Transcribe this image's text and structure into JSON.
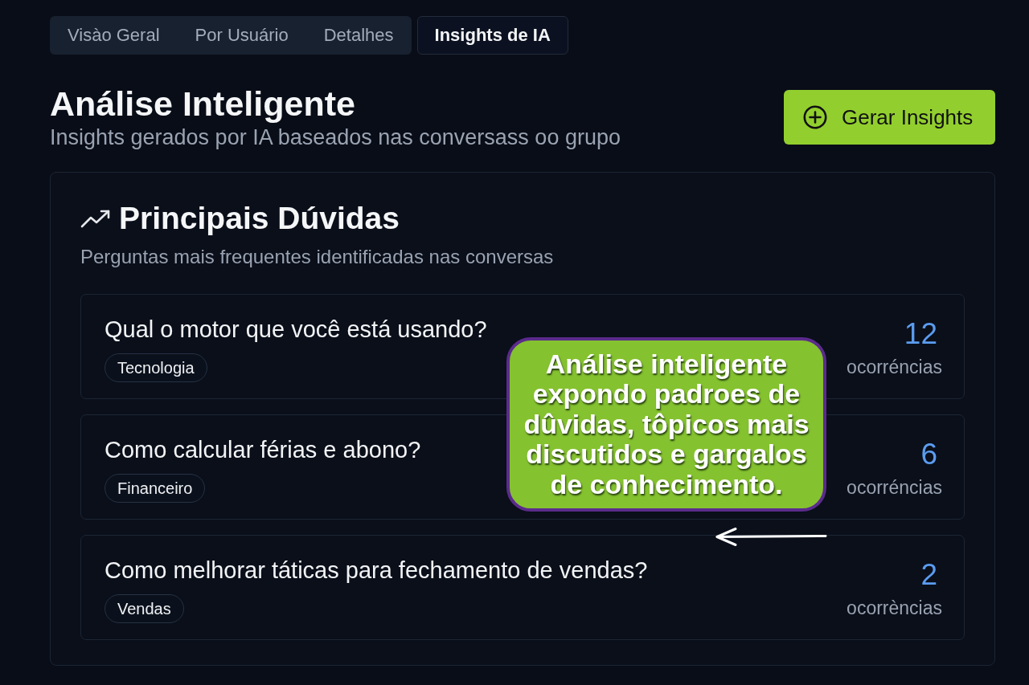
{
  "tabs": [
    {
      "label": "Visào Geral",
      "selected": false
    },
    {
      "label": "Por Usuário",
      "selected": false
    },
    {
      "label": "Detalhes",
      "selected": false
    },
    {
      "label": "Insights de IA",
      "selected": true
    }
  ],
  "header": {
    "title": "Análise Inteligente",
    "subtitle": "Insights gerados por IA baseados nas conversass oo grupo",
    "action_button": "Gerar Insights"
  },
  "card": {
    "title": "Principais Dúvidas",
    "description": "Perguntas mais frequentes identificadas nas conversas",
    "questions": [
      {
        "question": "Qual o motor que você está usando?",
        "tag": "Tecnologia",
        "count": "12",
        "count_label": "ocorréncias"
      },
      {
        "question": "Como calcular férias e abono?",
        "tag": "Financeiro",
        "count": "6",
        "count_label": "ocorréncias"
      },
      {
        "question": "Como melhorar táticas para fechamento de vendas?",
        "tag": "Vendas",
        "count": "2",
        "count_label": "ocorrèncias"
      }
    ]
  },
  "callout": {
    "text": "Análise inteligente\nexpondo padroes de\ndûvidas, tôpicos mais\ndiscutidos e gargalos\nde conhecimento."
  }
}
